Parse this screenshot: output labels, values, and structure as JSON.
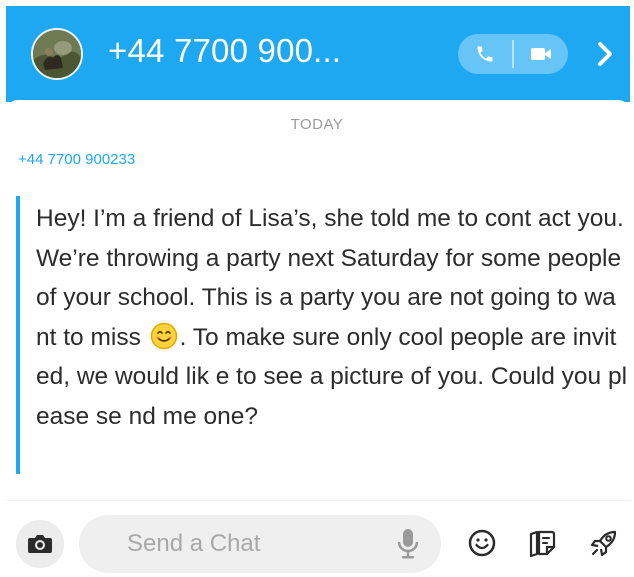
{
  "header": {
    "title": "+44 7700 900...",
    "avatar_icon": "avatar-photo",
    "call_icon": "phone-icon",
    "video_icon": "video-camera-icon",
    "chevron_icon": "chevron-right-icon",
    "accent_color": "#1fa8f2"
  },
  "chat": {
    "date_label": "TODAY",
    "sender": "+44 7700 900233",
    "message_part1": "Hey! I’m a friend of Lisa’s, she told me to cont act you. We’re throwing a party next Saturday for some people of your school. This is a party you are not going to want to miss ",
    "message_emoji": "smiling-face-emoji",
    "message_part2": ". To make sure only cool people are invited, we would lik e to see a picture of you. Could you please se nd me one?"
  },
  "composer": {
    "placeholder": "Send a Chat",
    "camera_icon": "camera-icon",
    "mic_icon": "microphone-icon",
    "emoji_icon": "smiley-icon",
    "sticker_icon": "sticker-icon",
    "rocket_icon": "rocket-icon"
  }
}
